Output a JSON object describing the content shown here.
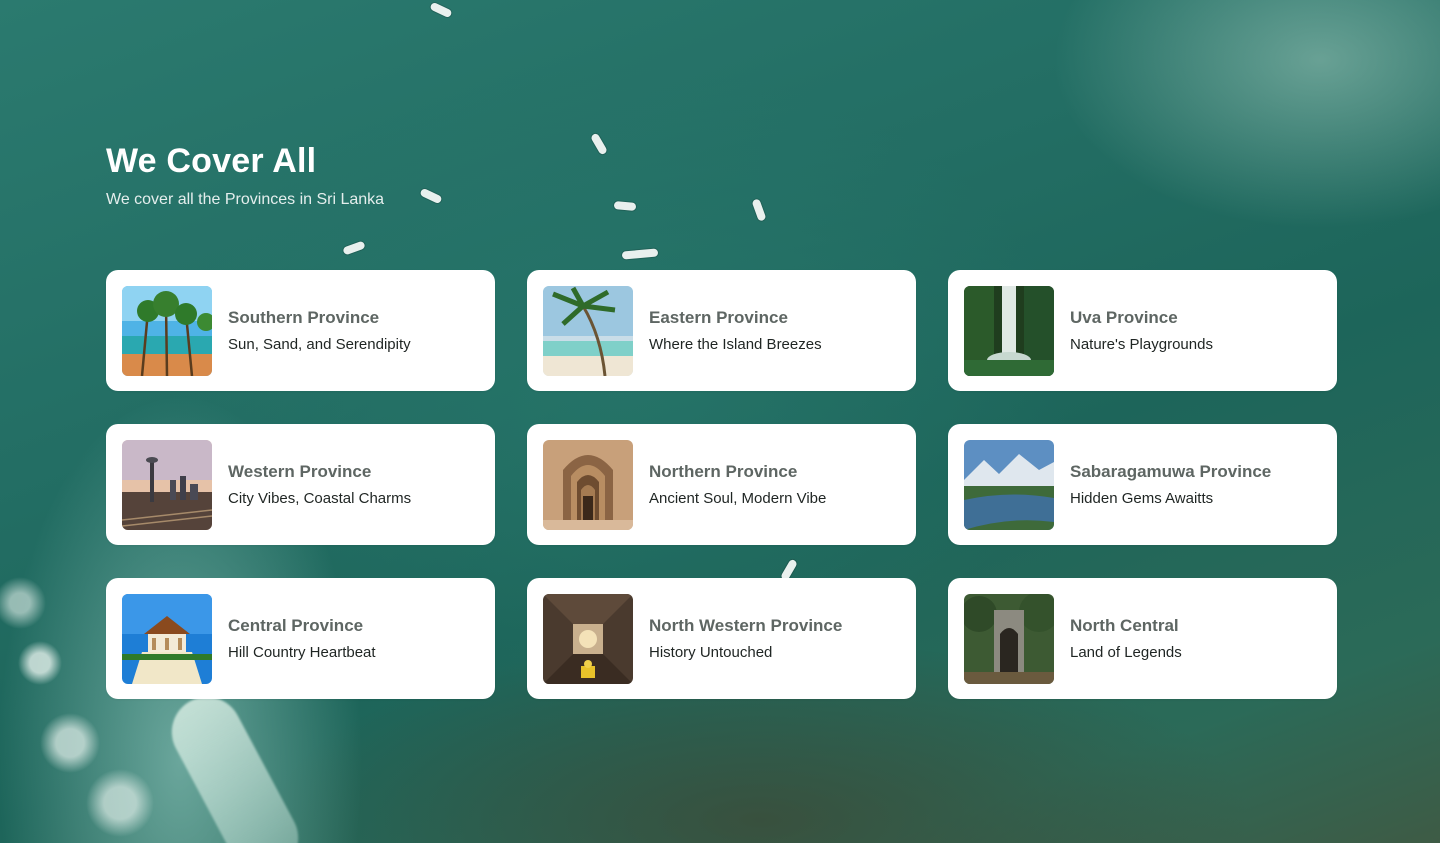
{
  "hero": {
    "title": "We Cover All",
    "subtitle": "We cover all the Provinces in Sri Lanka"
  },
  "provinces": [
    {
      "name": "Southern Province",
      "tagline": "Sun, Sand, and Serendipity",
      "image": "palm-beach-photo"
    },
    {
      "name": "Eastern Province",
      "tagline": "Where the Island Breezes",
      "image": "palm-shore-photo"
    },
    {
      "name": "Uva Province",
      "tagline": "Nature's Playgrounds",
      "image": "waterfall-photo"
    },
    {
      "name": "Western Province",
      "tagline": "City Vibes, Coastal Charms",
      "image": "city-tower-photo"
    },
    {
      "name": "Northern Province",
      "tagline": "Ancient Soul, Modern Vibe",
      "image": "stone-arches-photo"
    },
    {
      "name": "Sabaragamuwa Province",
      "tagline": "Hidden Gems Awaitts",
      "image": "river-mountain-photo"
    },
    {
      "name": "Central Province",
      "tagline": "Hill Country Heartbeat",
      "image": "temple-photo"
    },
    {
      "name": "North Western Province",
      "tagline": "History Untouched",
      "image": "stupa-interior-photo"
    },
    {
      "name": "North Central",
      "tagline": "Land of Legends",
      "image": "forest-ruin-photo"
    }
  ]
}
